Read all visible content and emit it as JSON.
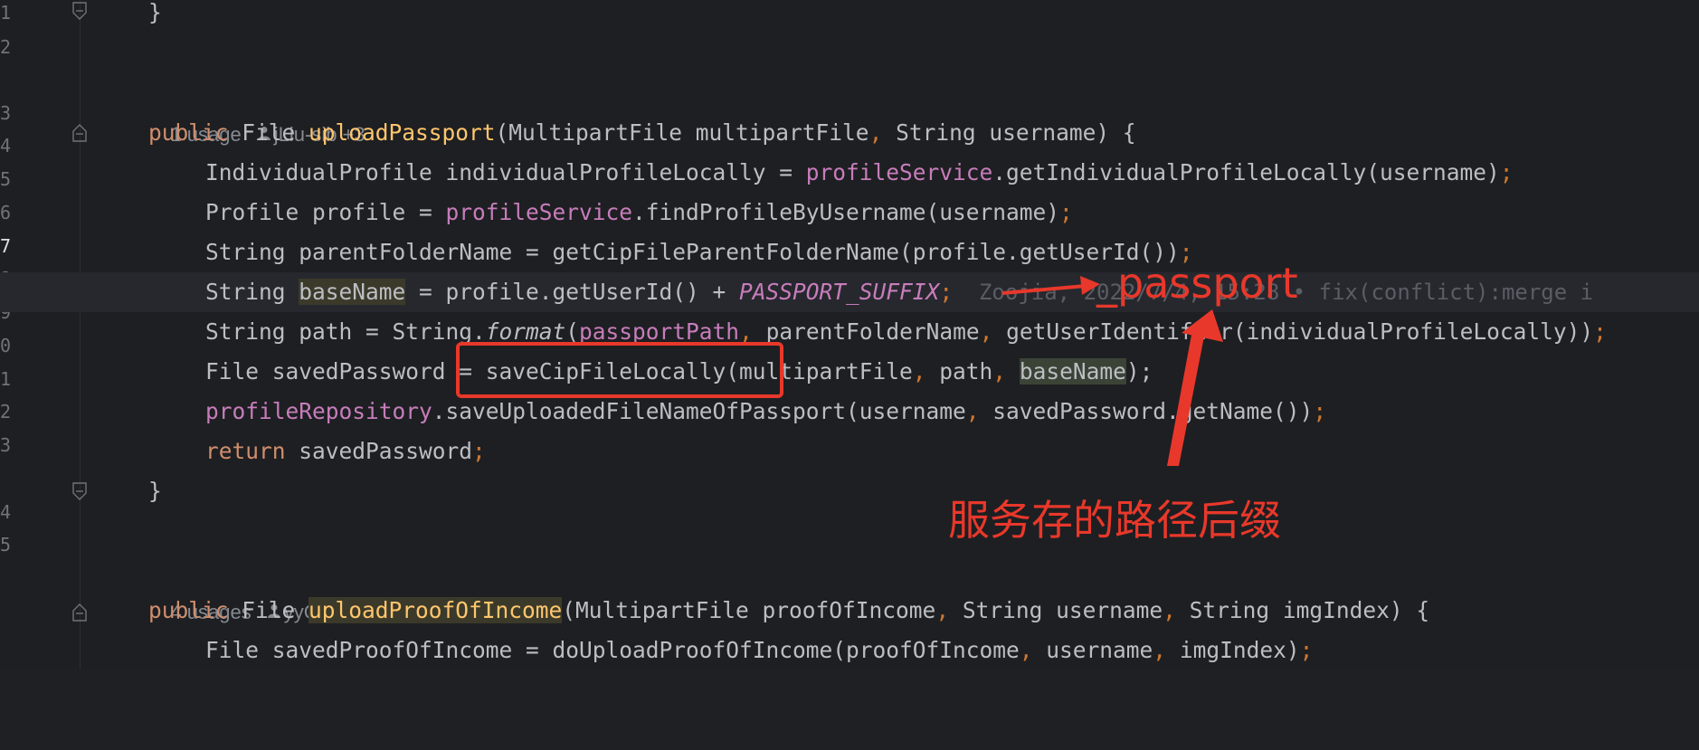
{
  "gutter": [
    "1",
    "2",
    "3",
    "4",
    "5",
    "6",
    "7",
    "8",
    "9",
    "0",
    "1",
    "2",
    "3",
    "4",
    "5"
  ],
  "lines": {
    "l1_brace": "}",
    "usage1": "1 usage",
    "author1": "jLiu-sib +3",
    "sig1_public": "public ",
    "sig1_type": "File ",
    "sig1_name": "uploadPassport",
    "sig1_params_a": "(MultipartFile multipartFile",
    "sig1_params_b": " String username) {",
    "l4_a": "IndividualProfile individualProfileLocally = ",
    "l4_field": "profileService",
    "l4_b": ".getIndividualProfileLocally(username)",
    "l5_a": "Profile profile = ",
    "l5_field": "profileService",
    "l5_b": ".findProfileByUsername(username)",
    "l6_a": "String parentFolderName = getCipFileParentFolderName(profile.getUserId())",
    "l7_a": "String ",
    "l7_var": "baseName",
    "l7_b": " = profile.getUserId() + ",
    "l7_const": "PASSPORT_SUFFIX",
    "l7_blame_a": "  Zoojia, 2022/7/4, ",
    "l7_blame_b": "15:28 • fix(conflict):merge i",
    "l8_a": "String path = String.",
    "l8_fmt": "format",
    "l8_b": "(",
    "l8_field": "passportPath",
    "l8_c": " parentFolderName",
    "l8_d": " getUserIdentifier(individualProfileLocally))",
    "l9_a": "File savedPassword = saveCipFileLocally(multipartFile",
    "l9_b": " path",
    "l9_var": "baseName",
    "l9_c": ");",
    "l10_field": "profileRepository",
    "l10_a": ".saveUploadedFileNameOfPassport(username",
    "l10_b": " savedPassword.getName())",
    "l11_kw": "return",
    "l11_a": " savedPassword",
    "l12_brace": "}",
    "usage2": "4 usages",
    "author2": "yyChen-sib",
    "sig2_public": "public ",
    "sig2_type": "File ",
    "sig2_name": "uploadProofOfIncome",
    "sig2_params_a": "(MultipartFile proofOfIncome",
    "sig2_params_b": " String username",
    "sig2_params_c": " String imgIndex) {",
    "l15_a": "File savedProofOfIncome = doUploadProofOfIncome(proofOfIncome",
    "l15_b": " username",
    "l15_c": " imgIndex)",
    "semi": ";",
    "comma": ","
  },
  "annotations": {
    "suffix_label": "_passport",
    "note_label": "服务存的路径后缀"
  },
  "colors": {
    "annotation_red": "#e8382b",
    "keyword": "#cf8e6d",
    "method_decl": "#ffc66d",
    "field": "#c77dbb"
  }
}
